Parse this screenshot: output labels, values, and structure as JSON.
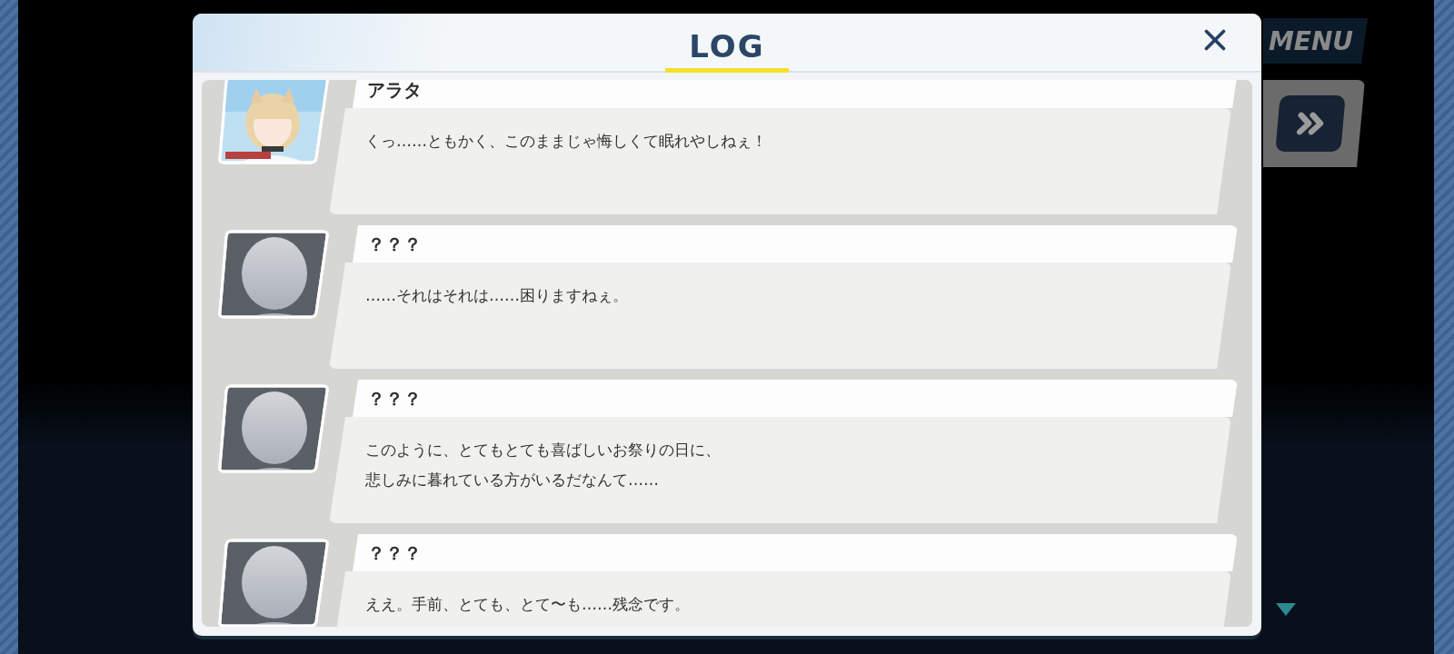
{
  "dialog": {
    "title": "LOG"
  },
  "entries": [
    {
      "speaker": "アラタ",
      "avatar": {
        "kind": "picture"
      },
      "message": [
        "くっ……ともかく、このままじゃ悔しくて眠れやしねぇ！"
      ]
    },
    {
      "speaker": "？？？",
      "avatar": {
        "kind": "silhouette"
      },
      "message": [
        "……それはそれは……困りますねぇ。"
      ]
    },
    {
      "speaker": "？？？",
      "avatar": {
        "kind": "silhouette"
      },
      "message": [
        "このように、とてもとても喜ばしいお祭りの日に、",
        "悲しみに暮れている方がいるだなんて……"
      ]
    },
    {
      "speaker": "？？？",
      "avatar": {
        "kind": "silhouette"
      },
      "message": [
        "ええ。手前、とても、とて〜も……残念です。"
      ]
    }
  ],
  "menu_button": "MENU"
}
